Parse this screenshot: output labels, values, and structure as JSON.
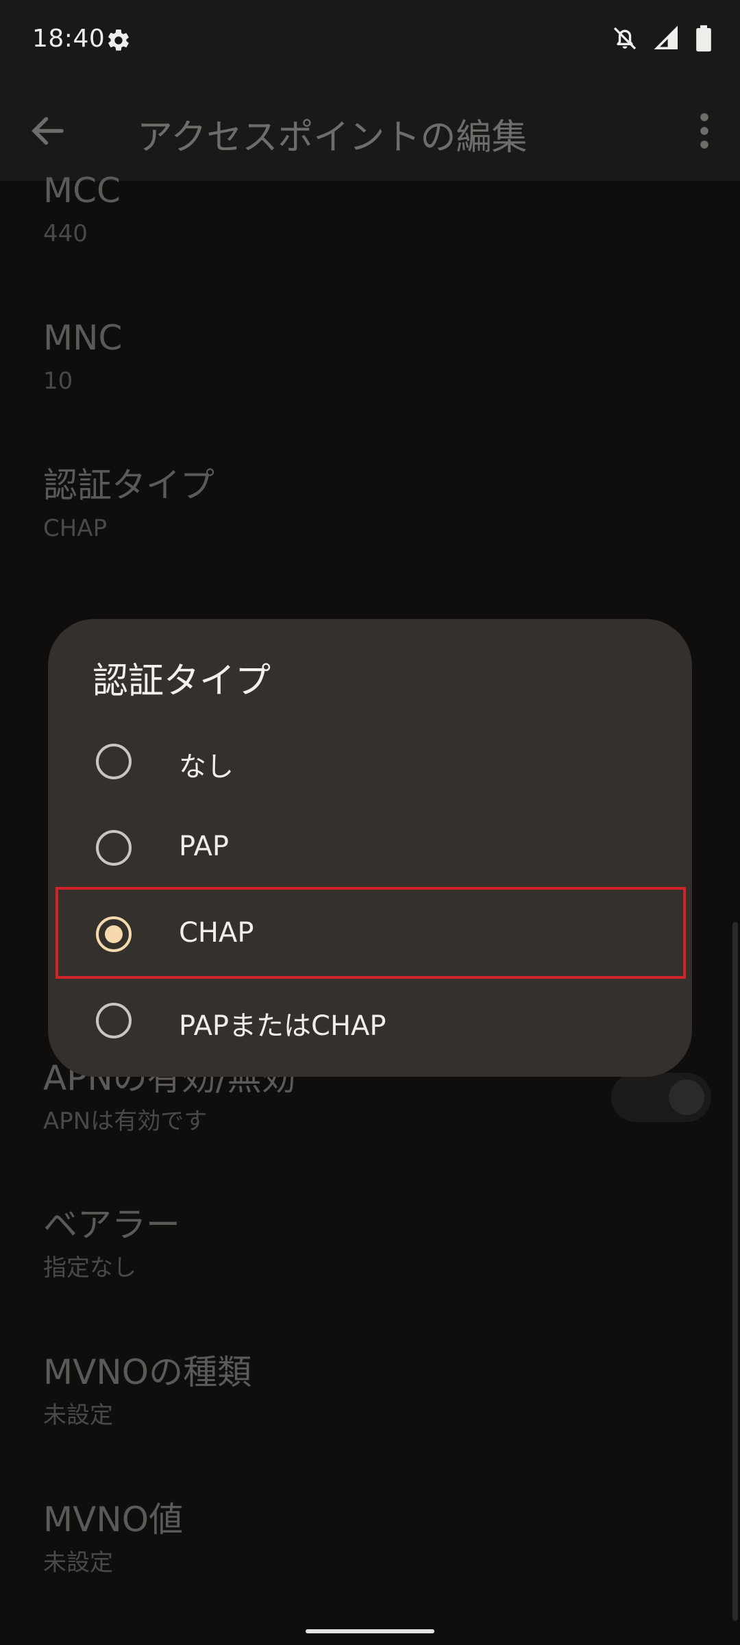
{
  "status_bar": {
    "time": "18:40",
    "icons": [
      "gear-icon",
      "notifications-off-icon",
      "signal-icon",
      "battery-icon"
    ]
  },
  "app_bar": {
    "title": "アクセスポイントの編集"
  },
  "list": [
    {
      "title": "MCC",
      "subtitle": "440"
    },
    {
      "title": "MNC",
      "subtitle": "10"
    },
    {
      "title": "認証タイプ",
      "subtitle": "CHAP"
    },
    {
      "title": "APNの有効/無効",
      "subtitle": "APNは有効です"
    },
    {
      "title": "ベアラー",
      "subtitle": "指定なし"
    },
    {
      "title": "MVNOの種類",
      "subtitle": "未設定"
    },
    {
      "title": "MVNO値",
      "subtitle": "未設定"
    }
  ],
  "dialog": {
    "title": "認証タイプ",
    "options": [
      {
        "label": "なし",
        "selected": false
      },
      {
        "label": "PAP",
        "selected": false
      },
      {
        "label": "CHAP",
        "selected": true
      },
      {
        "label": "PAPまたはCHAP",
        "selected": false
      }
    ]
  },
  "colors": {
    "accent": "#f6d9ad",
    "highlight": "#d1232a",
    "dialog_bg": "#34312d"
  }
}
